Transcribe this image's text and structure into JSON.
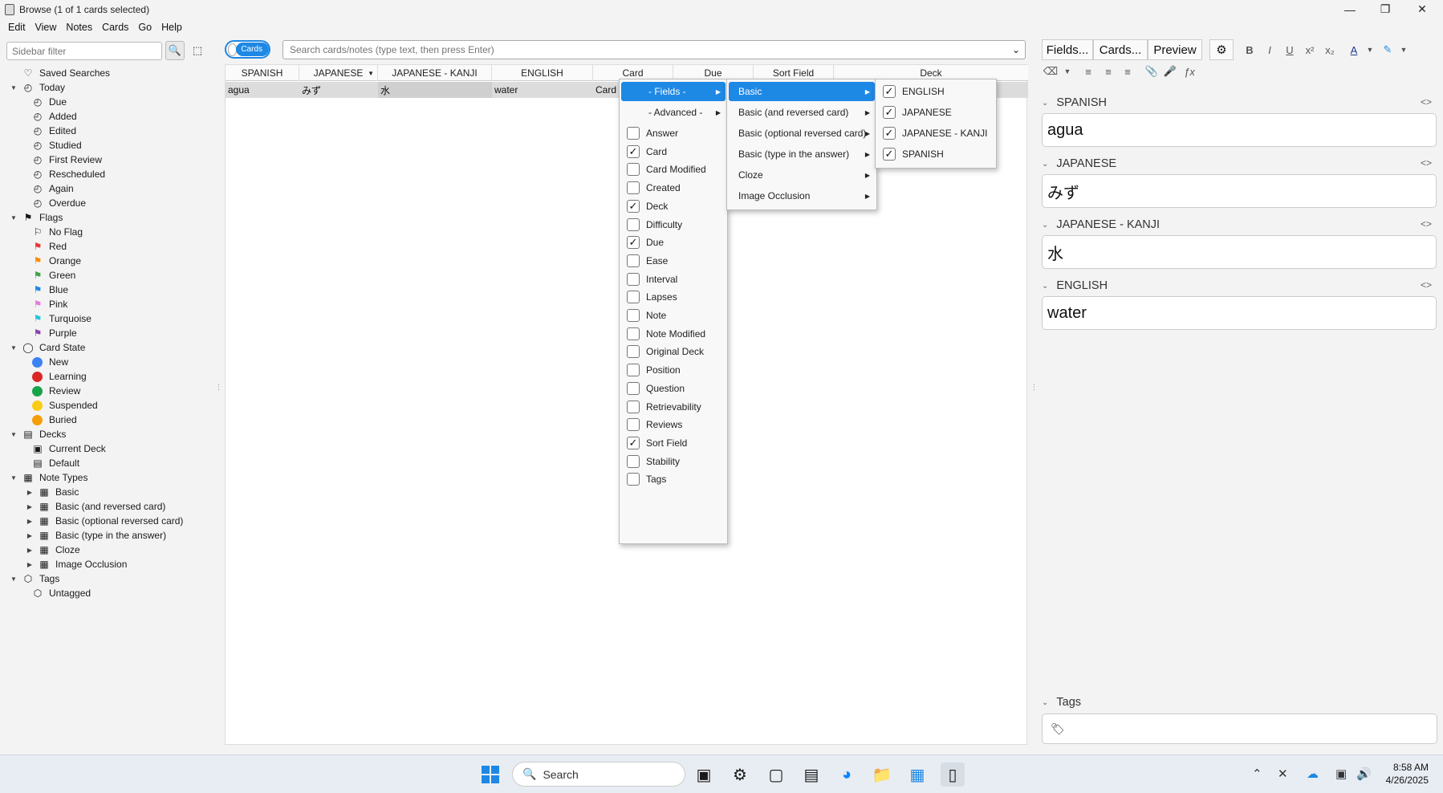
{
  "window": {
    "title": "Browse (1 of 1 cards selected)"
  },
  "menubar": [
    "Edit",
    "View",
    "Notes",
    "Cards",
    "Go",
    "Help"
  ],
  "sidebar": {
    "filter_placeholder": "Sidebar filter",
    "items": [
      {
        "label": "Saved Searches",
        "icon": "heart-icon",
        "level": 0,
        "arrow": ""
      },
      {
        "label": "Today",
        "icon": "clock-icon",
        "level": 0,
        "arrow": "down"
      },
      {
        "label": "Due",
        "icon": "clock-icon",
        "level": 1
      },
      {
        "label": "Added",
        "icon": "clock-icon",
        "level": 1
      },
      {
        "label": "Edited",
        "icon": "clock-icon",
        "level": 1
      },
      {
        "label": "Studied",
        "icon": "clock-icon",
        "level": 1
      },
      {
        "label": "First Review",
        "icon": "clock-icon",
        "level": 1
      },
      {
        "label": "Rescheduled",
        "icon": "clock-icon",
        "level": 1
      },
      {
        "label": "Again",
        "icon": "clock-icon",
        "level": 1
      },
      {
        "label": "Overdue",
        "icon": "clock-icon",
        "level": 1
      },
      {
        "label": "Flags",
        "icon": "flag-icon",
        "level": 0,
        "arrow": "down"
      },
      {
        "label": "No Flag",
        "icon": "no-flag-icon",
        "level": 1
      },
      {
        "label": "Red",
        "icon": "flag-icon",
        "level": 1,
        "color": "#e53935"
      },
      {
        "label": "Orange",
        "icon": "flag-icon",
        "level": 1,
        "color": "#fb8c00"
      },
      {
        "label": "Green",
        "icon": "flag-icon",
        "level": 1,
        "color": "#43a047"
      },
      {
        "label": "Blue",
        "icon": "flag-icon",
        "level": 1,
        "color": "#1e88e5"
      },
      {
        "label": "Pink",
        "icon": "flag-icon",
        "level": 1,
        "color": "#e67be0"
      },
      {
        "label": "Turquoise",
        "icon": "flag-icon",
        "level": 1,
        "color": "#26c6da"
      },
      {
        "label": "Purple",
        "icon": "flag-icon",
        "level": 1,
        "color": "#8e44ad"
      },
      {
        "label": "Card State",
        "icon": "circle-icon",
        "level": 0,
        "arrow": "down"
      },
      {
        "label": "New",
        "icon": "dot-icon",
        "level": 1,
        "color": "#3b82f6"
      },
      {
        "label": "Learning",
        "icon": "dot-icon",
        "level": 1,
        "color": "#dc2626"
      },
      {
        "label": "Review",
        "icon": "dot-icon",
        "level": 1,
        "color": "#16a34a"
      },
      {
        "label": "Suspended",
        "icon": "dot-icon",
        "level": 1,
        "color": "#facc15"
      },
      {
        "label": "Buried",
        "icon": "dot-icon",
        "level": 1,
        "color": "#f59e0b"
      },
      {
        "label": "Decks",
        "icon": "deck-icon",
        "level": 0,
        "arrow": "down"
      },
      {
        "label": "Current Deck",
        "icon": "current-deck-icon",
        "level": 1
      },
      {
        "label": "Default",
        "icon": "deck-icon",
        "level": 1
      },
      {
        "label": "Note Types",
        "icon": "table-icon",
        "level": 0,
        "arrow": "down"
      },
      {
        "label": "Basic",
        "icon": "table-icon",
        "level": 1,
        "arrow": "right"
      },
      {
        "label": "Basic (and reversed card)",
        "icon": "table-icon",
        "level": 1,
        "arrow": "right"
      },
      {
        "label": "Basic (optional reversed card)",
        "icon": "table-icon",
        "level": 1,
        "arrow": "right"
      },
      {
        "label": "Basic (type in the answer)",
        "icon": "table-icon",
        "level": 1,
        "arrow": "right"
      },
      {
        "label": "Cloze",
        "icon": "table-icon",
        "level": 1,
        "arrow": "right"
      },
      {
        "label": "Image Occlusion",
        "icon": "table-icon",
        "level": 1,
        "arrow": "right"
      },
      {
        "label": "Tags",
        "icon": "tag-icon",
        "level": 0,
        "arrow": "down"
      },
      {
        "label": "Untagged",
        "icon": "untagged-icon",
        "level": 1
      }
    ]
  },
  "toolbar": {
    "toggle_label": "Cards",
    "search_placeholder": "Search cards/notes (type text, then press Enter)"
  },
  "table": {
    "columns": [
      "SPANISH",
      "JAPANESE",
      "JAPANESE - KANJI",
      "ENGLISH",
      "Card",
      "Due",
      "Sort Field",
      "Deck"
    ],
    "row": [
      "agua",
      "みず",
      "水",
      "water",
      "Card"
    ]
  },
  "menus": {
    "columns": {
      "fields_label": "- Fields -",
      "advanced_label": "- Advanced -",
      "items": [
        {
          "label": "Answer",
          "checked": false
        },
        {
          "label": "Card",
          "checked": true
        },
        {
          "label": "Card Modified",
          "checked": false
        },
        {
          "label": "Created",
          "checked": false
        },
        {
          "label": "Deck",
          "checked": true
        },
        {
          "label": "Difficulty",
          "checked": false
        },
        {
          "label": "Due",
          "checked": true
        },
        {
          "label": "Ease",
          "checked": false
        },
        {
          "label": "Interval",
          "checked": false
        },
        {
          "label": "Lapses",
          "checked": false
        },
        {
          "label": "Note",
          "checked": false
        },
        {
          "label": "Note Modified",
          "checked": false
        },
        {
          "label": "Original Deck",
          "checked": false
        },
        {
          "label": "Position",
          "checked": false
        },
        {
          "label": "Question",
          "checked": false
        },
        {
          "label": "Retrievability",
          "checked": false
        },
        {
          "label": "Reviews",
          "checked": false
        },
        {
          "label": "Sort Field",
          "checked": true
        },
        {
          "label": "Stability",
          "checked": false
        },
        {
          "label": "Tags",
          "checked": false
        }
      ]
    },
    "note_types": [
      "Basic",
      "Basic (and reversed card)",
      "Basic (optional reversed card)",
      "Basic (type in the answer)",
      "Cloze",
      "Image Occlusion"
    ],
    "basic_fields": [
      {
        "label": "ENGLISH",
        "checked": true
      },
      {
        "label": "JAPANESE",
        "checked": true
      },
      {
        "label": "JAPANESE - KANJI",
        "checked": true
      },
      {
        "label": "SPANISH",
        "checked": true
      }
    ]
  },
  "editor": {
    "buttons": [
      "Fields...",
      "Cards...",
      "Preview"
    ],
    "fields": [
      {
        "name": "SPANISH",
        "value": "agua"
      },
      {
        "name": "JAPANESE",
        "value": "みず"
      },
      {
        "name": "JAPANESE - KANJI",
        "value": "水"
      },
      {
        "name": "ENGLISH",
        "value": "water"
      }
    ],
    "tags_label": "Tags"
  },
  "taskbar": {
    "search_label": "Search",
    "time": "8:58 AM",
    "date": "4/26/2025"
  },
  "colors": {
    "accent": "#1e88e5",
    "selected_row": "#dcdcdc"
  }
}
